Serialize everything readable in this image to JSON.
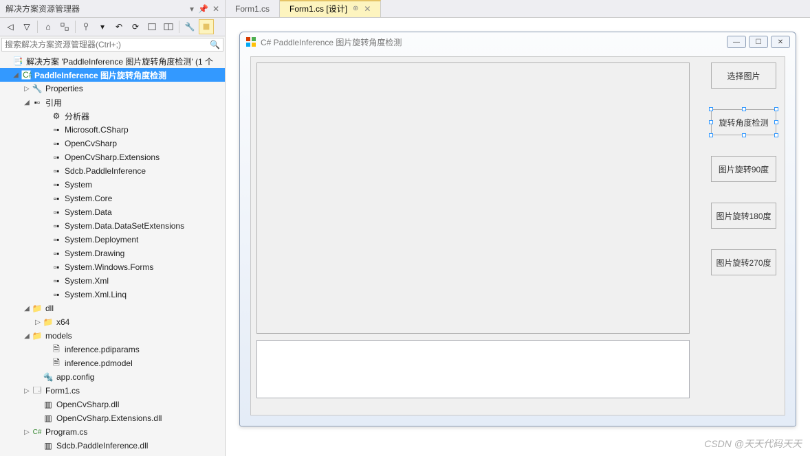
{
  "panel": {
    "title": "解决方案资源管理器",
    "search_placeholder": "搜索解决方案资源管理器(Ctrl+;)"
  },
  "tree": {
    "solution": "解决方案 'PaddleInference 图片旋转角度检测' (1 个",
    "project": "PaddleInference 图片旋转角度检测",
    "properties": "Properties",
    "references": "引用",
    "ref_items": [
      "分析器",
      "Microsoft.CSharp",
      "OpenCvSharp",
      "OpenCvSharp.Extensions",
      "Sdcb.PaddleInference",
      "System",
      "System.Core",
      "System.Data",
      "System.Data.DataSetExtensions",
      "System.Deployment",
      "System.Drawing",
      "System.Windows.Forms",
      "System.Xml",
      "System.Xml.Linq"
    ],
    "dll": "dll",
    "x64": "x64",
    "models": "models",
    "model_items": [
      "inference.pdiparams",
      "inference.pdmodel"
    ],
    "appconfig": "app.config",
    "form1": "Form1.cs",
    "ocvdll": "OpenCvSharp.dll",
    "ocvextdll": "OpenCvSharp.Extensions.dll",
    "program": "Program.cs",
    "paddledll": "Sdcb.PaddleInference.dll"
  },
  "tabs": {
    "tab1": "Form1.cs",
    "tab2": "Form1.cs [设计]"
  },
  "form": {
    "title": "C# PaddleInference 图片旋转角度检测",
    "buttons": [
      "选择图片",
      "旋转角度检测",
      "图片旋转90度",
      "图片旋转180度",
      "图片旋转270度"
    ]
  },
  "watermark": "CSDN @天天代码天天"
}
